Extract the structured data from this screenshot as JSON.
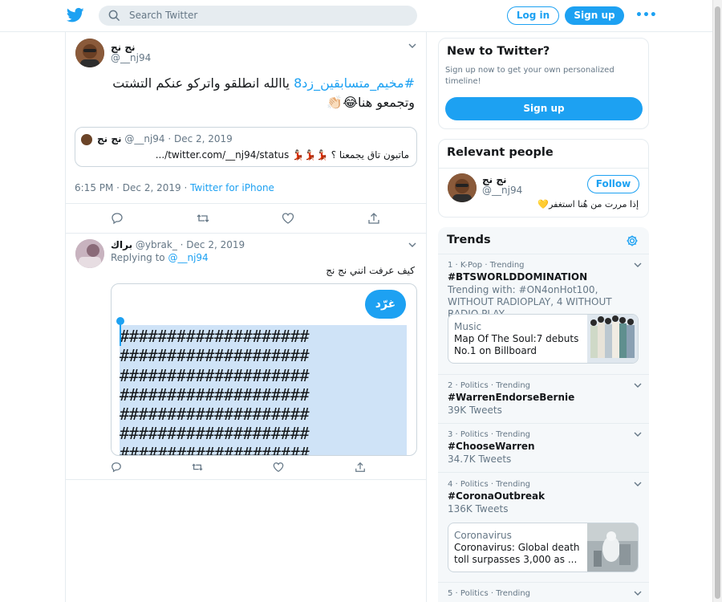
{
  "header": {
    "search_placeholder": "Search Twitter",
    "login_label": "Log in",
    "signup_label": "Sign up",
    "more_label": "•••",
    "brand_color": "#1da1f2"
  },
  "tweet": {
    "name": "نج نج",
    "handle": "@__nj94",
    "hashtag": "#مخيم_متسابقين_زد8",
    "text": " ياالله انطلقو واتركو عنكم التشتت وتجمعو هنا😂👏🏻",
    "quote": {
      "name": "نج نج",
      "handle_date": "@__nj94 · Dec 2, 2019",
      "text": "ماتبون تاق يجمعنا ؟ 💃🏻💃🏻💃🏻 twitter.com/__nj94/status/..."
    },
    "time": "6:15 PM · Dec 2, 2019 · ",
    "source": "Twitter for iPhone"
  },
  "reply": {
    "name": "براك",
    "handle_date": " @ybrak_ · Dec 2, 2019",
    "replying_label": "Replying to ",
    "replying_handle": "@__nj94",
    "text": "كيف عرفت انني نج نج",
    "media_button": "غرّد",
    "media_rows": [
      "####################",
      "####################",
      "####################",
      "####################",
      "####################",
      "####################",
      "####################"
    ]
  },
  "sidebar": {
    "new_title": "New to Twitter?",
    "new_text": "Sign up now to get your own personalized timeline!",
    "new_button": "Sign up",
    "relevant_title": "Relevant people",
    "relevant_name": "نج نج",
    "relevant_handle": "@__nj94",
    "relevant_follow": "Follow",
    "relevant_bio": "إذا مررت من هُنا استغفر💛",
    "trends_title": "Trends",
    "trends": [
      {
        "meta": "1 · K-Pop · Trending",
        "title": "#BTSWORLDDOMINATION",
        "sub": "Trending with: #ON4onHot100, WITHOUT RADIOPLAY, 4 WITHOUT RADIO PLAY"
      },
      {
        "meta": "2 · Politics · Trending",
        "title": "#WarrenEndorseBernie",
        "sub": "39K Tweets"
      },
      {
        "meta": "3 · Politics · Trending",
        "title": "#ChooseWarren",
        "sub": "34.7K Tweets"
      },
      {
        "meta": "4 · Politics · Trending",
        "title": "#CoronaOutbreak",
        "sub": "136K Tweets"
      },
      {
        "meta": "5 · Politics · Trending",
        "title": "",
        "sub": ""
      }
    ],
    "news": [
      {
        "cat": "Music",
        "title": "Map Of The Soul:7 debuts No.1 on Billboard"
      },
      {
        "cat": "Coronavirus",
        "title": "Coronavirus: Global death toll surpasses 3,000 as ..."
      }
    ]
  }
}
